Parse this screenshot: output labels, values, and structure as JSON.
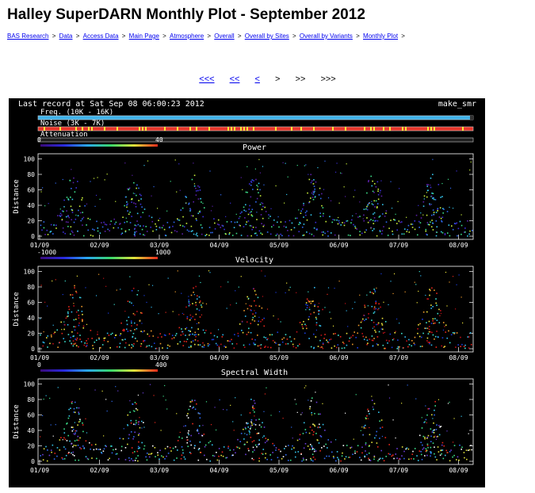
{
  "page": {
    "title": "Halley SuperDARN Monthly Plot - September 2012"
  },
  "breadcrumb": [
    {
      "label": "BAS Research"
    },
    {
      "label": "Data"
    },
    {
      "label": "Access Data"
    },
    {
      "label": "Main Page"
    },
    {
      "label": "Atmosphere"
    },
    {
      "label": "Overall"
    },
    {
      "label": "Overall by Sites"
    },
    {
      "label": "Overall by Variants"
    },
    {
      "label": "Monthly Plot"
    }
  ],
  "breadcrumb_sep": ">",
  "pager": {
    "first": "<<<",
    "prev_month": "<<",
    "prev": "<",
    "next": ">",
    "next_month": ">>",
    "last": ">>>"
  },
  "plot": {
    "header_left": "Last record at Sat Sep 08 06:00:23 2012",
    "header_right": "make_smr",
    "status_bars": [
      {
        "label": "Freq. (10K - 16K)",
        "color": "#3fb2ea"
      },
      {
        "label": "Noise (3K - 7K)",
        "color": "#e8362a"
      },
      {
        "label": "Attenuation",
        "color": "#1e1e1e"
      }
    ],
    "panels": [
      {
        "title": "Power",
        "scale_min": "0",
        "scale_max": "40",
        "ylabel": "Distance",
        "palette": "power"
      },
      {
        "title": "Velocity",
        "scale_min": "-1000",
        "scale_max": "1000",
        "ylabel": "Distance",
        "palette": "velocity"
      },
      {
        "title": "Spectral Width",
        "scale_min": "0",
        "scale_max": "400",
        "ylabel": "Distance",
        "palette": "width"
      }
    ],
    "y_ticks": [
      "0",
      "20",
      "40",
      "60",
      "80",
      "100"
    ],
    "x_ticks": [
      "01/09",
      "02/09",
      "03/09",
      "04/09",
      "05/09",
      "06/09",
      "07/09",
      "08/09"
    ]
  },
  "colors": {
    "link": "#0000ee",
    "plot_bg": "#000000",
    "axis": "#ffffff"
  }
}
